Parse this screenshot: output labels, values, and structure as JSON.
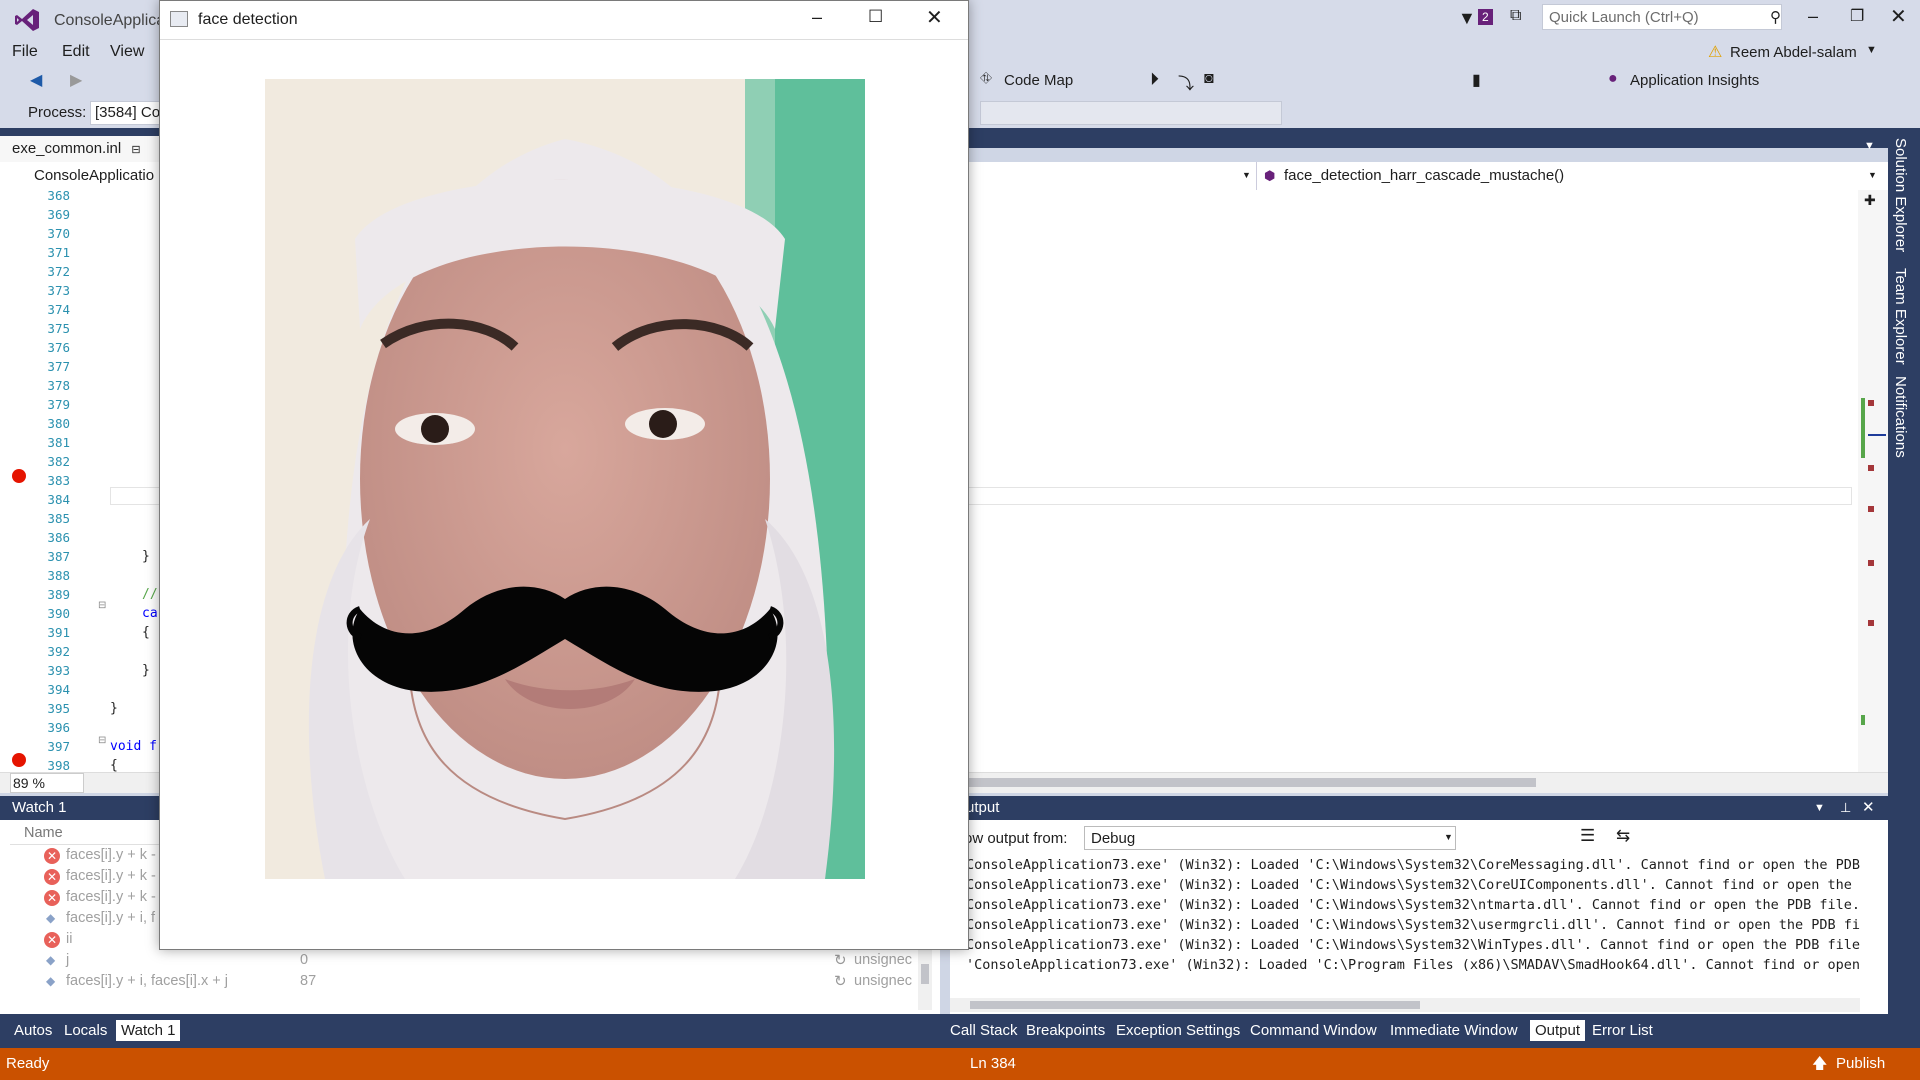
{
  "window": {
    "title": "ConsoleApplica",
    "notification_count": "2",
    "quick_launch_placeholder": "Quick Launch (Ctrl+Q)",
    "user": "Reem Abdel-salam"
  },
  "menu": [
    "File",
    "Edit",
    "View"
  ],
  "toolbar": {
    "code_map": "Code Map",
    "app_insights": "Application Insights"
  },
  "process": {
    "label": "Process:",
    "value": "[3584] Co"
  },
  "editor": {
    "tab": "exe_common.inl",
    "nav_left": "ConsoleApplicatio",
    "nav_right": "face_detection_harr_cascade_mustache()",
    "zoom": "89 %",
    "line_numbers": [
      "368",
      "369",
      "370",
      "371",
      "372",
      "373",
      "374",
      "375",
      "376",
      "377",
      "378",
      "379",
      "380",
      "381",
      "382",
      "383",
      "384",
      "385",
      "386",
      "387",
      "388",
      "389",
      "390",
      "391",
      "392",
      "393",
      "394",
      "395",
      "396",
      "397",
      "398"
    ],
    "code_fragments": [
      {
        "line": "387",
        "text": "}"
      },
      {
        "line": "389",
        "text": "//"
      },
      {
        "line": "390",
        "text": "ca"
      },
      {
        "line": "391",
        "text": "{"
      },
      {
        "line": "393",
        "text": "}"
      },
      {
        "line": "395",
        "text": "}"
      },
      {
        "line": "397",
        "text": "void f"
      },
      {
        "line": "398",
        "text": "{"
      }
    ]
  },
  "right_tabs": [
    "Solution Explorer",
    "Team Explorer",
    "Notifications"
  ],
  "watch": {
    "title": "Watch 1",
    "col_name": "Name",
    "rows": [
      {
        "name": "faces[i].y + k -",
        "value": "",
        "type": "",
        "error": true
      },
      {
        "name": "faces[i].y + k -",
        "value": "",
        "type": "",
        "error": true
      },
      {
        "name": "faces[i].y + k -",
        "value": "",
        "type": "",
        "error": true
      },
      {
        "name": "faces[i].y + i, f",
        "value": "",
        "type": "",
        "error": false
      },
      {
        "name": "ii",
        "value": "",
        "type": "",
        "error": true
      },
      {
        "name": "j",
        "value": "0",
        "type": "unsignec",
        "error": false
      },
      {
        "name": "faces[i].y + i, faces[i].x + j",
        "value": "87",
        "type": "unsignec",
        "error": false
      }
    ]
  },
  "output": {
    "title": "utput",
    "show_from_label": "ow output from:",
    "source": "Debug",
    "lines": [
      "ConsoleApplication73.exe' (Win32): Loaded 'C:\\Windows\\System32\\CoreMessaging.dll'. Cannot find or open the PDB",
      "ConsoleApplication73.exe' (Win32): Loaded 'C:\\Windows\\System32\\CoreUIComponents.dll'. Cannot find or open the PI",
      "ConsoleApplication73.exe' (Win32): Loaded 'C:\\Windows\\System32\\ntmarta.dll'. Cannot find or open the PDB file.",
      "ConsoleApplication73.exe' (Win32): Loaded 'C:\\Windows\\System32\\usermgrcli.dll'. Cannot find or open the PDB fil",
      "ConsoleApplication73.exe' (Win32): Loaded 'C:\\Windows\\System32\\WinTypes.dll'. Cannot find or open the PDB file.",
      "'ConsoleApplication73.exe' (Win32): Loaded 'C:\\Program Files (x86)\\SMADAV\\SmadHook64.dll'. Cannot find or open th"
    ]
  },
  "bottom_tabs_left": [
    "Autos",
    "Locals",
    "Watch 1"
  ],
  "bottom_tabs_right": [
    "Call Stack",
    "Breakpoints",
    "Exception Settings",
    "Command Window",
    "Immediate Window",
    "Output",
    "Error List"
  ],
  "status": {
    "left": "Ready",
    "line": "Ln 384",
    "publish": "Publish"
  },
  "face_window": {
    "title": "face detection"
  },
  "colors": {
    "vs_dark": "#2d3e63",
    "vs_chrome": "#d6dbe9",
    "status_orange": "#ca5100",
    "breakpoint": "#e51400"
  }
}
